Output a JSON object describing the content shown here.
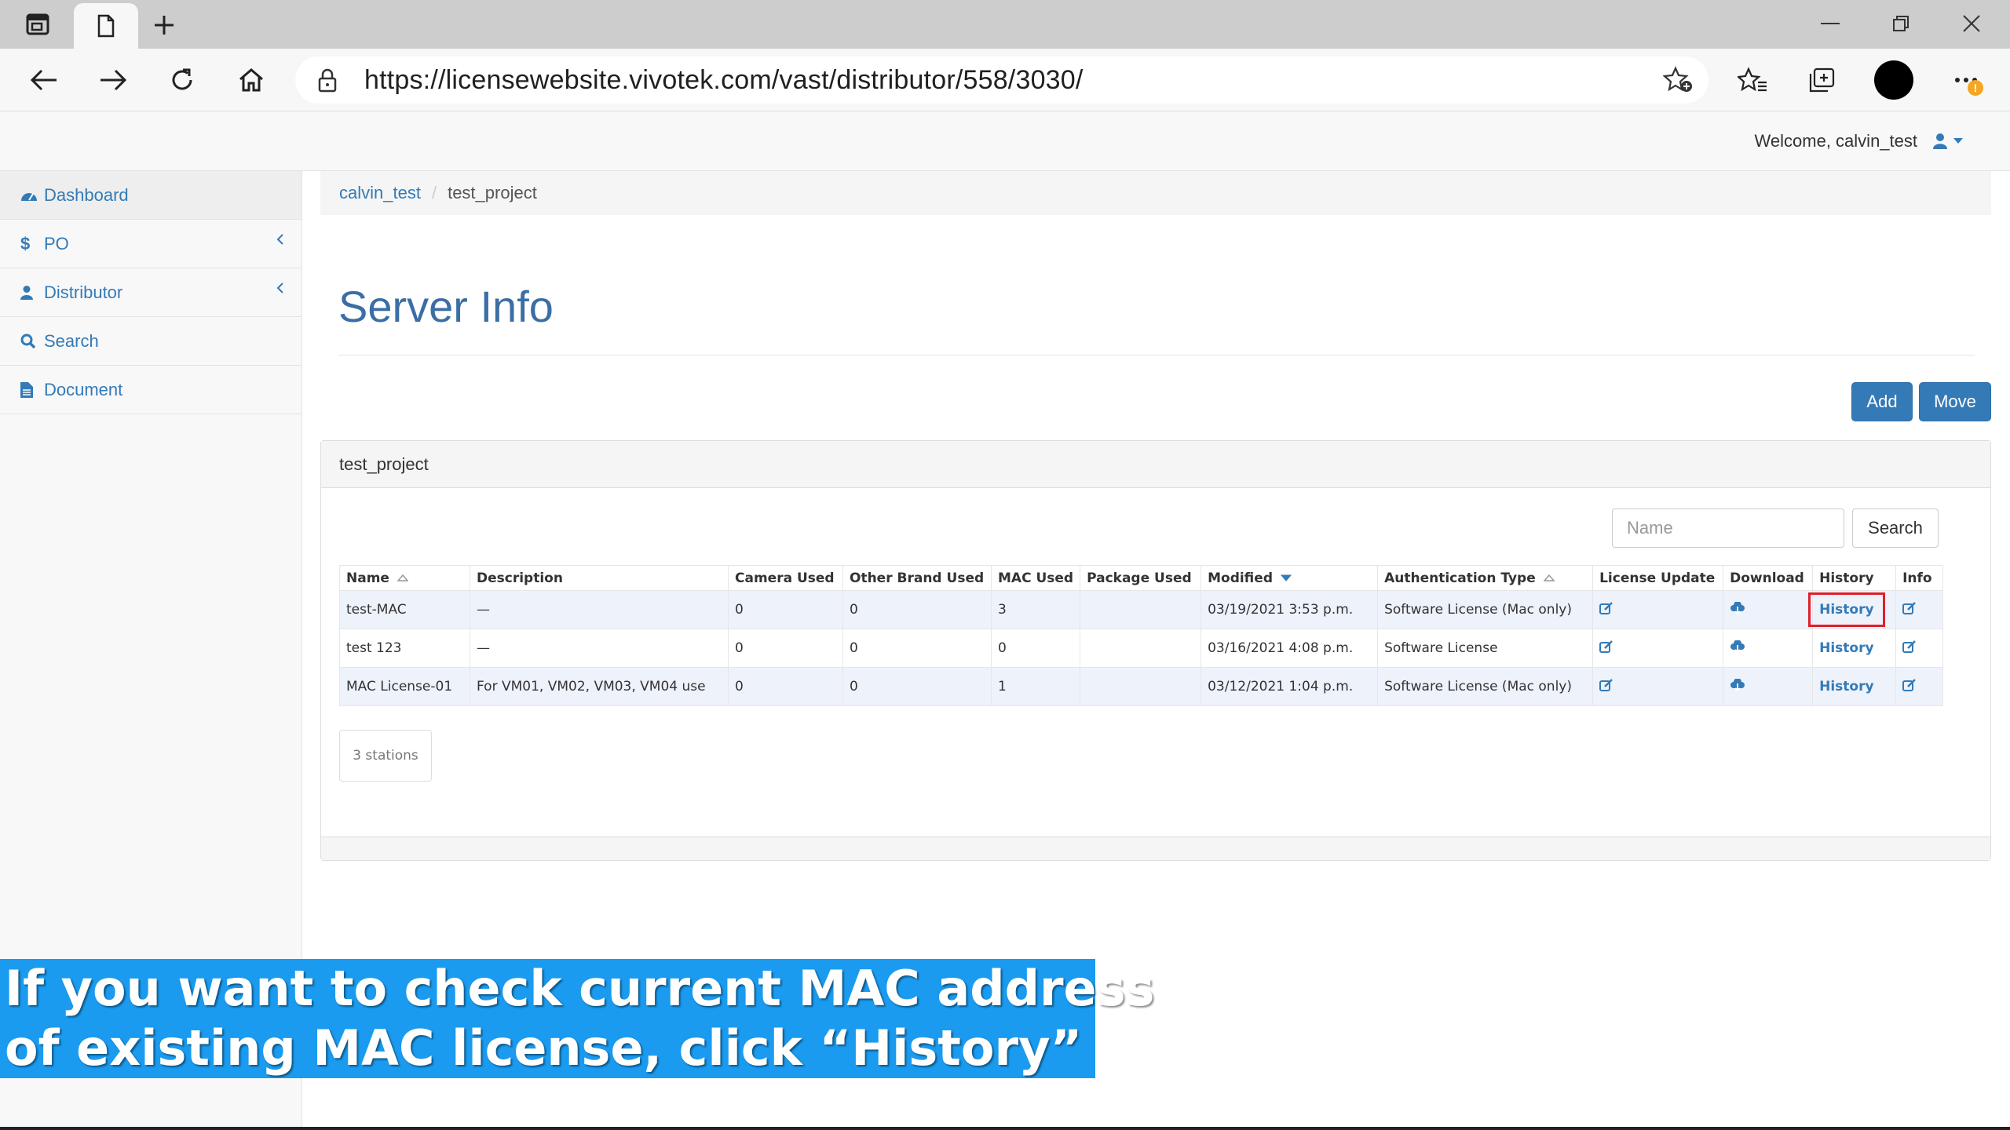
{
  "browser": {
    "url": "https://licensewebsite.vivotek.com/vast/distributor/558/3030/",
    "notification_count": "!"
  },
  "header": {
    "welcome_text": "Welcome, calvin_test"
  },
  "sidebar": {
    "items": [
      {
        "label": "Dashboard",
        "icon": "dashboard-icon"
      },
      {
        "label": "PO",
        "icon": "dollar-icon"
      },
      {
        "label": "Distributor",
        "icon": "user-icon"
      },
      {
        "label": "Search",
        "icon": "search-icon"
      },
      {
        "label": "Document",
        "icon": "document-icon"
      }
    ]
  },
  "breadcrumb": {
    "items": [
      "calvin_test",
      "test_project"
    ],
    "separator": "/"
  },
  "page": {
    "title": "Server Info",
    "add_label": "Add",
    "move_label": "Move"
  },
  "panel": {
    "title": "test_project",
    "search_placeholder": "Name",
    "search_button": "Search",
    "footer_count": "3 stations"
  },
  "table": {
    "columns": [
      "Name",
      "Description",
      "Camera Used",
      "Other Brand Used",
      "MAC Used",
      "Package Used",
      "Modified",
      "Authentication Type",
      "License Update",
      "Download",
      "History",
      "Info"
    ],
    "rows": [
      {
        "name": "test-MAC",
        "description": "—",
        "camera_used": "0",
        "other_brand_used": "0",
        "mac_used": "3",
        "package_used": "",
        "modified": "03/19/2021 3:53 p.m.",
        "auth_type": "Software License (Mac only)",
        "history": "History"
      },
      {
        "name": "test 123",
        "description": "—",
        "camera_used": "0",
        "other_brand_used": "0",
        "mac_used": "0",
        "package_used": "",
        "modified": "03/16/2021 4:08 p.m.",
        "auth_type": "Software License",
        "history": "History"
      },
      {
        "name": "MAC License-01",
        "description": "For VM01, VM02, VM03, VM04 use",
        "camera_used": "0",
        "other_brand_used": "0",
        "mac_used": "1",
        "package_used": "",
        "modified": "03/12/2021 1:04 p.m.",
        "auth_type": "Software License (Mac only)",
        "history": "History"
      }
    ]
  },
  "caption": {
    "line1": "If you want to check current MAC address",
    "line2": "of existing MAC license, click “History”"
  },
  "colors": {
    "primary": "#337ab7",
    "highlight": "#e0202a",
    "caption_bg": "#1a9bf0",
    "row_alt": "#eef2fb"
  }
}
